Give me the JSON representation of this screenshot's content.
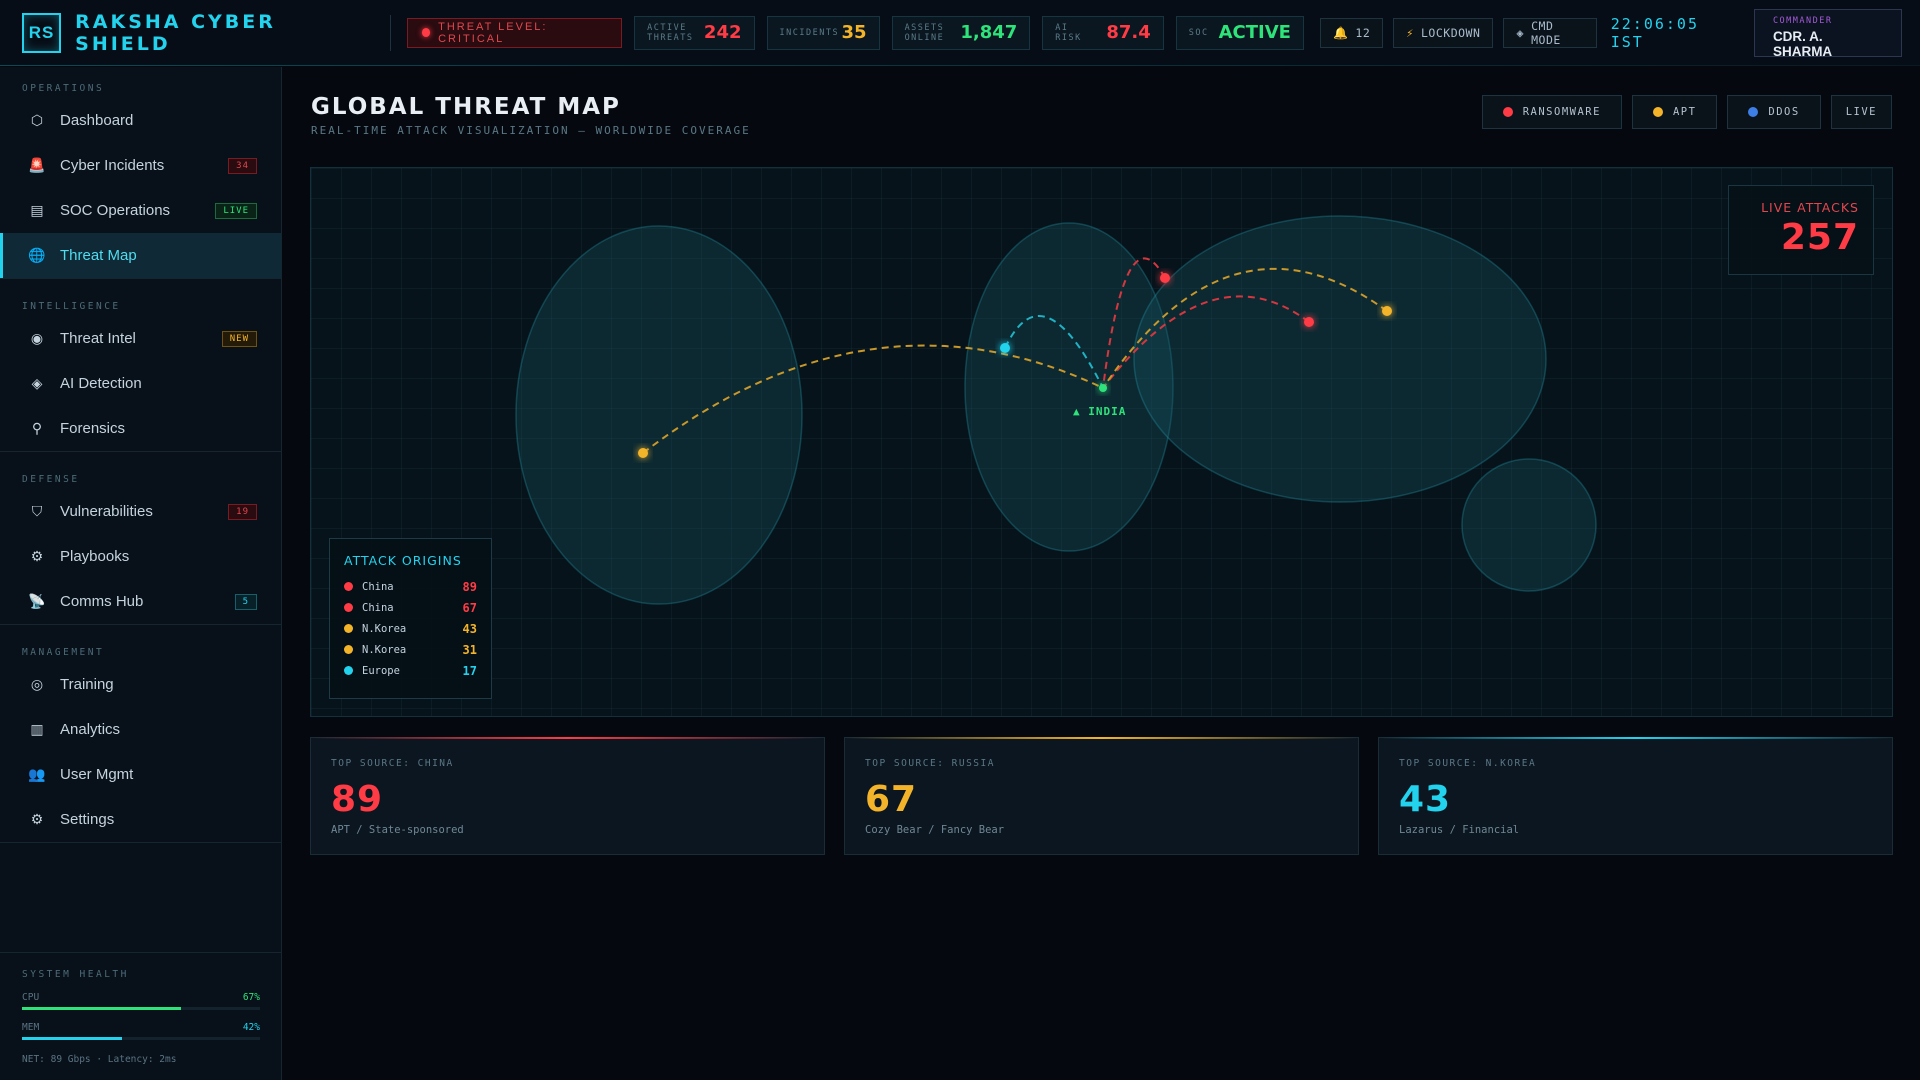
{
  "app": {
    "logo": "RS",
    "title": "RAKSHA CYBER SHIELD"
  },
  "topbar": {
    "threat_level": "THREAT LEVEL: CRITICAL",
    "stats": [
      {
        "label": "ACTIVE THREATS",
        "value": "242",
        "color": "#ff3b45"
      },
      {
        "label": "INCIDENTS",
        "value": "35",
        "color": "#f4b42a"
      },
      {
        "label": "ASSETS ONLINE",
        "value": "1,847",
        "color": "#2ee37a"
      },
      {
        "label": "AI RISK",
        "value": "87.4",
        "color": "#ff3b45"
      },
      {
        "label": "SOC",
        "value": "ACTIVE",
        "color": "#2ee37a"
      }
    ],
    "notifications": "12",
    "lockdown": "LOCKDOWN",
    "cmd_mode": "CMD MODE",
    "clock": "22:06:05 IST",
    "commander_role": "COMMANDER",
    "commander_name": "CDR. A. SHARMA"
  },
  "sidebar": {
    "sections": [
      {
        "title": "OPERATIONS",
        "items": [
          {
            "label": "Dashboard",
            "icon": "hexagon-icon",
            "glyph": "⬡"
          },
          {
            "label": "Cyber Incidents",
            "icon": "siren-icon",
            "glyph": "🚨",
            "badge": "34",
            "badge_color": "red"
          },
          {
            "label": "SOC Operations",
            "icon": "server-icon",
            "glyph": "▤",
            "badge": "LIVE",
            "badge_color": "green"
          },
          {
            "label": "Threat Map",
            "icon": "globe-icon",
            "glyph": "🌐",
            "active": true
          }
        ]
      },
      {
        "title": "INTELLIGENCE",
        "items": [
          {
            "label": "Threat Intel",
            "icon": "brain-icon",
            "glyph": "◉",
            "badge": "NEW",
            "badge_color": "yellow"
          },
          {
            "label": "AI Detection",
            "icon": "diamond-icon",
            "glyph": "◈"
          },
          {
            "label": "Forensics",
            "icon": "microscope-icon",
            "glyph": "⚲"
          }
        ]
      },
      {
        "title": "DEFENSE",
        "items": [
          {
            "label": "Vulnerabilities",
            "icon": "shield-icon",
            "glyph": "⛉",
            "badge": "19",
            "badge_color": "red"
          },
          {
            "label": "Playbooks",
            "icon": "gear-icon",
            "glyph": "⚙"
          },
          {
            "label": "Comms Hub",
            "icon": "satellite-icon",
            "glyph": "📡",
            "badge": "5",
            "badge_color": "cyan"
          }
        ]
      },
      {
        "title": "MANAGEMENT",
        "items": [
          {
            "label": "Training",
            "icon": "target-icon",
            "glyph": "◎"
          },
          {
            "label": "Analytics",
            "icon": "bar-chart-icon",
            "glyph": "▥"
          },
          {
            "label": "User Mgmt",
            "icon": "users-icon",
            "glyph": "👥"
          },
          {
            "label": "Settings",
            "icon": "settings-icon",
            "glyph": "⚙"
          }
        ]
      }
    ],
    "health": {
      "title": "SYSTEM HEALTH",
      "cpu_label": "CPU",
      "cpu_value": "67%",
      "cpu": 0.67,
      "mem_label": "MEM",
      "mem_value": "42%",
      "mem": 0.42,
      "net": "NET: 89 Gbps · Latency: 2ms"
    }
  },
  "main": {
    "title": "GLOBAL THREAT MAP",
    "subtitle": "REAL-TIME ATTACK VISUALIZATION — WORLDWIDE COVERAGE",
    "filters": [
      {
        "label": "RANSOMWARE",
        "color": "#ff3b45"
      },
      {
        "label": "APT",
        "color": "#f4b42a"
      },
      {
        "label": "DDOS",
        "color": "#3d7fe6"
      },
      {
        "label": "LIVE",
        "color": ""
      }
    ],
    "live_attacks_label": "LIVE ATTACKS",
    "live_attacks_value": "257",
    "target_label": "▲ INDIA",
    "origins_title": "ATTACK ORIGINS",
    "origins": [
      {
        "country": "China",
        "value": "89",
        "color": "#ff3b45"
      },
      {
        "country": "China",
        "value": "67",
        "color": "#ff3b45"
      },
      {
        "country": "N.Korea",
        "value": "43",
        "color": "#f4b42a"
      },
      {
        "country": "N.Korea",
        "value": "31",
        "color": "#f4b42a"
      },
      {
        "country": "Europe",
        "value": "17",
        "color": "#23d3ee"
      }
    ],
    "cards": [
      {
        "label": "TOP SOURCE: CHINA",
        "value": "89",
        "desc": "APT / State-sponsored",
        "color": "#ff3b45"
      },
      {
        "label": "TOP SOURCE: RUSSIA",
        "value": "67",
        "desc": "Cozy Bear / Fancy Bear",
        "color": "#f4b42a"
      },
      {
        "label": "TOP SOURCE: N.KOREA",
        "value": "43",
        "desc": "Lazarus / Financial",
        "color": "#23d3ee"
      }
    ]
  }
}
